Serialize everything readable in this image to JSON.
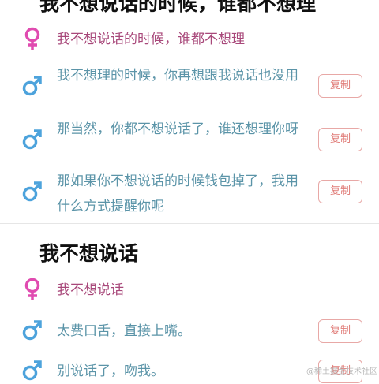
{
  "sections": [
    {
      "title": "我不想说话的时候，谁都不想理",
      "female_line": "我不想说话的时候，谁都不想理",
      "replies": [
        {
          "text": "我不想理的时候，你再想跟我说话也没用",
          "copy_label": "复制"
        },
        {
          "text": "那当然，你都不想说话了，谁还想理你呀",
          "copy_label": "复制"
        },
        {
          "text": "那如果你不想说话的时候钱包掉了，我用什么方式提醒你呢",
          "copy_label": "复制"
        }
      ]
    },
    {
      "title": "我不想说话",
      "female_line": "我不想说话",
      "replies": [
        {
          "text": "太费口舌，直接上嘴。",
          "copy_label": "复制"
        },
        {
          "text": "别说话了，吻我。",
          "copy_label": "复制"
        }
      ]
    }
  ],
  "watermark": "@稀土掘金技术社区",
  "colors": {
    "female": "#e04bb0",
    "male": "#4da3dc",
    "copy_border": "#e8a8a6"
  }
}
